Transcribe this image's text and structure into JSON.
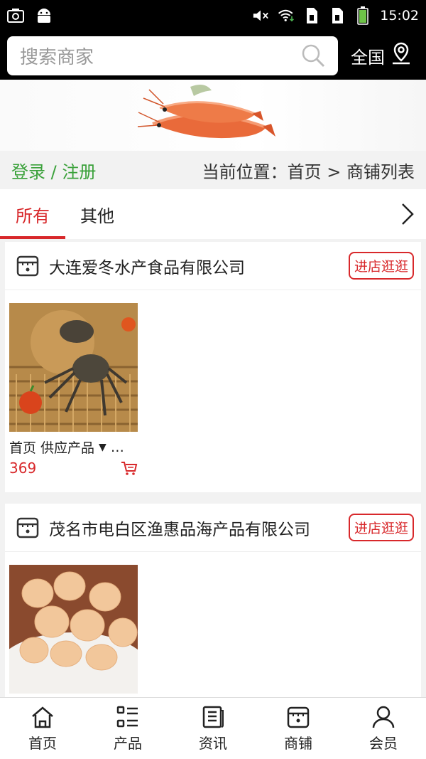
{
  "status_bar": {
    "time": "15:02",
    "icons": [
      "screenshot-icon",
      "android-icon",
      "mute-icon",
      "wifi-icon",
      "sim-icon",
      "sim-icon",
      "battery-icon"
    ]
  },
  "search": {
    "placeholder": "搜索商家",
    "region_label": "全国"
  },
  "breadcrumb": {
    "login_label": "登录 / 注册",
    "location_label": "当前位置：首页 > 商铺列表"
  },
  "tabs": [
    {
      "label": "所有",
      "active": true
    },
    {
      "label": "其他",
      "active": false
    }
  ],
  "stores": [
    {
      "name": "大连爱冬水产食品有限公司",
      "visit_label": "进店逛逛",
      "product": {
        "title": "首页 供应产品",
        "more": "…",
        "price": "369"
      }
    },
    {
      "name": "茂名市电白区渔惠品海产品有限公司",
      "visit_label": "进店逛逛"
    }
  ],
  "bottom_nav": [
    {
      "label": "首页",
      "icon": "home-icon"
    },
    {
      "label": "产品",
      "icon": "list-icon"
    },
    {
      "label": "资讯",
      "icon": "news-icon"
    },
    {
      "label": "商铺",
      "icon": "store-icon"
    },
    {
      "label": "会员",
      "icon": "user-icon"
    }
  ],
  "colors": {
    "accent": "#d8282b",
    "login_green": "#3aa13a"
  }
}
